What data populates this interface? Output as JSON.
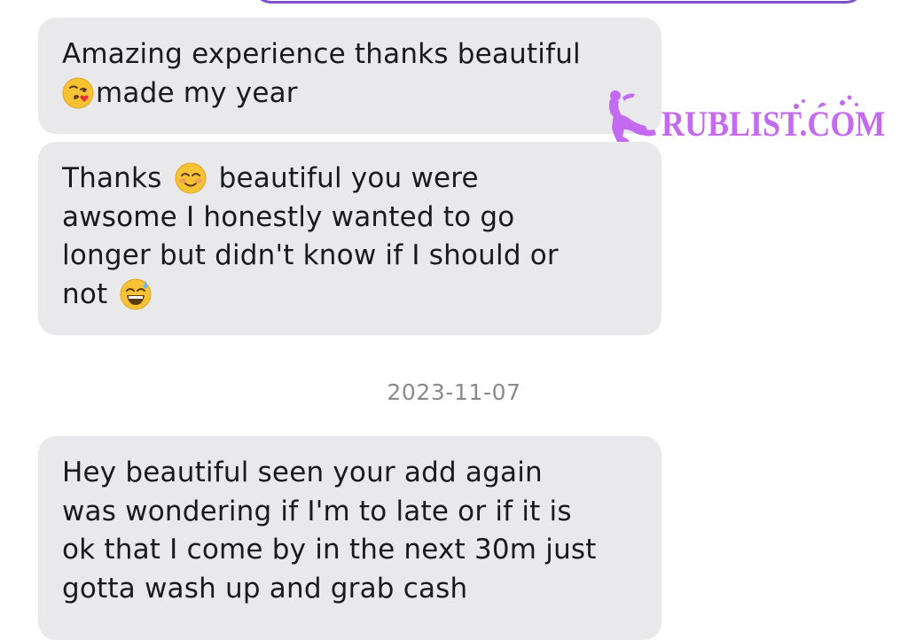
{
  "messages": [
    {
      "pre": "Amazing experience thanks beautiful\n",
      "emoji": "kissing-face-with-heart",
      "post": "made my year"
    },
    {
      "line1_a": "Thanks",
      "emoji1": "smiling-blush-face",
      "line1_b": "beautiful you were",
      "body": "\nawsome I honestly wanted to go\nlonger but didn't know if I should or\nnot",
      "emoji2": "grinning-sweat-face"
    },
    {
      "text": "Hey beautiful seen your add again\nwas wondering if I'm to  late or if it is\nok that I come by in the next 30m just\ngotta wash up and grab cash"
    }
  ],
  "date_separator": "2023-11-07",
  "watermark": {
    "text": "RUBLIST.COM",
    "color": "#c46af0"
  },
  "colors": {
    "bubble_bg": "#e9e9eb",
    "outgoing_border": "#7b52c9",
    "date_text": "#8a8a8e"
  }
}
